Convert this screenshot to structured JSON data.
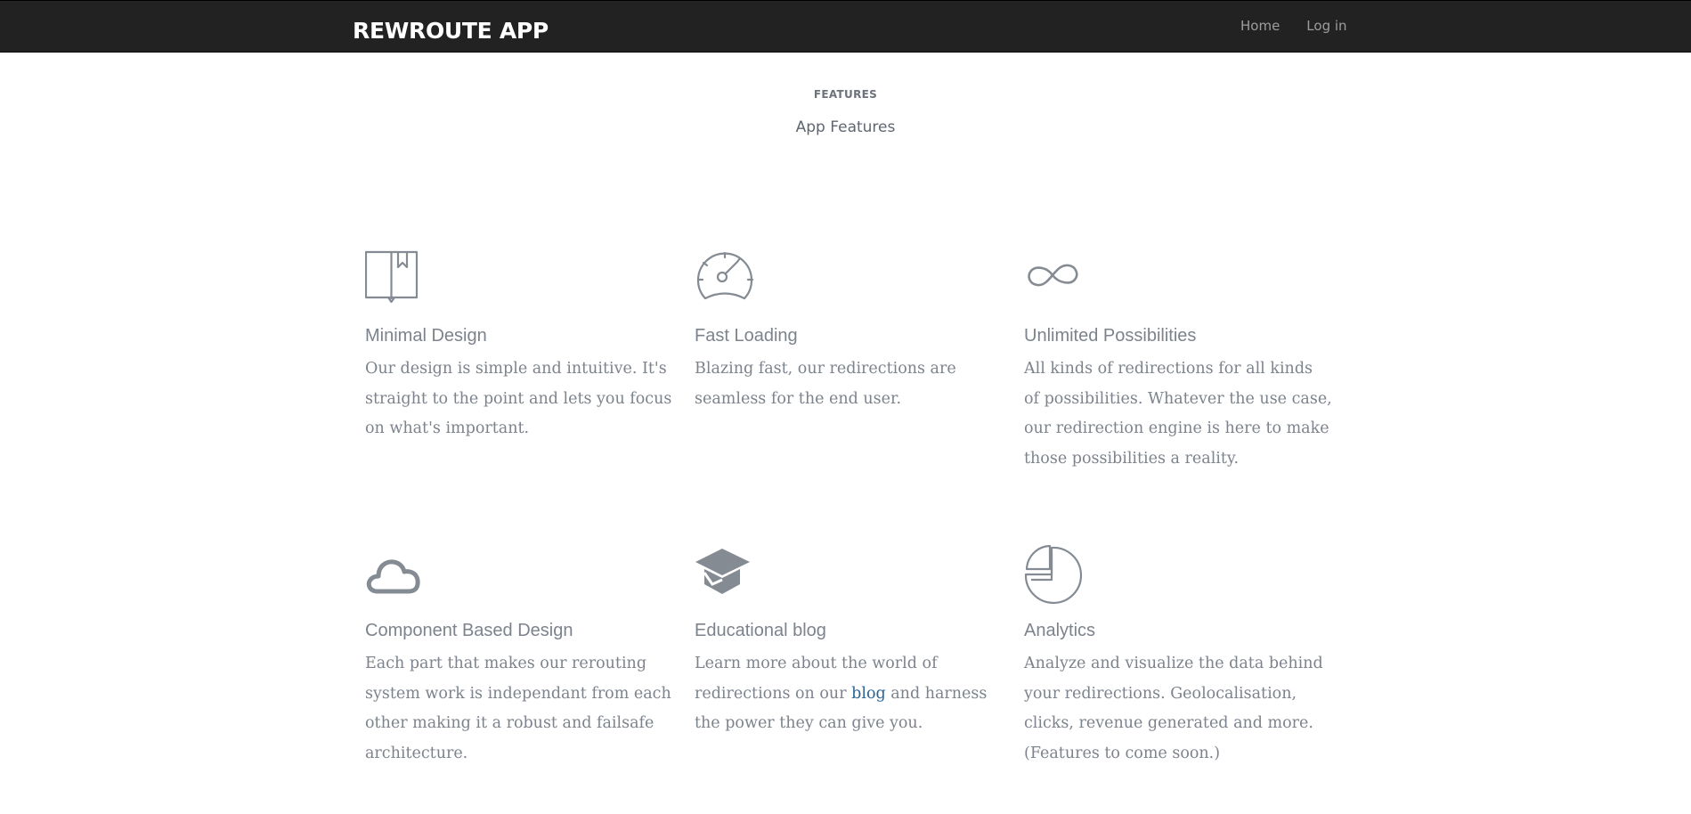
{
  "navbar": {
    "brand": "REWROUTE APP",
    "links": [
      "Home",
      "Log in"
    ]
  },
  "section": {
    "kicker": "FEATURES",
    "title": "App Features"
  },
  "features": [
    {
      "icon": "book-icon",
      "title": "Minimal Design",
      "text": "Our design is simple and intuitive. It's straight to the point and lets you focus on what's important."
    },
    {
      "icon": "speedometer-icon",
      "title": "Fast Loading",
      "text": "Blazing fast, our redirections are seamless for the end user."
    },
    {
      "icon": "infinity-icon",
      "title": "Unlimited Possibilities",
      "text": "All kinds of redirections for all kinds of possibilities. Whatever the use case, our redirection engine is here to make those possibilities a reality."
    },
    {
      "icon": "cloud-icon",
      "title": "Component Based Design",
      "text": "Each part that makes our rerouting system work is independant from each other making it a robust and failsafe architecture."
    },
    {
      "icon": "graduation-cap-icon",
      "title": "Educational blog",
      "text_before": "Learn more about the world of redirections on our ",
      "link": "blog",
      "text_after": " and harness the power they can give you."
    },
    {
      "icon": "pie-chart-icon",
      "title": "Analytics",
      "text": "Analyze and visualize the data behind your redirections. Geolocalisation, clicks, revenue generated and more. (Features to come soon.)"
    }
  ],
  "colors": {
    "navbar_bg": "#222222",
    "brand": "#ffffff",
    "nav_link": "#9d9d9d",
    "text": "#7d838c",
    "link": "#2a6496"
  }
}
